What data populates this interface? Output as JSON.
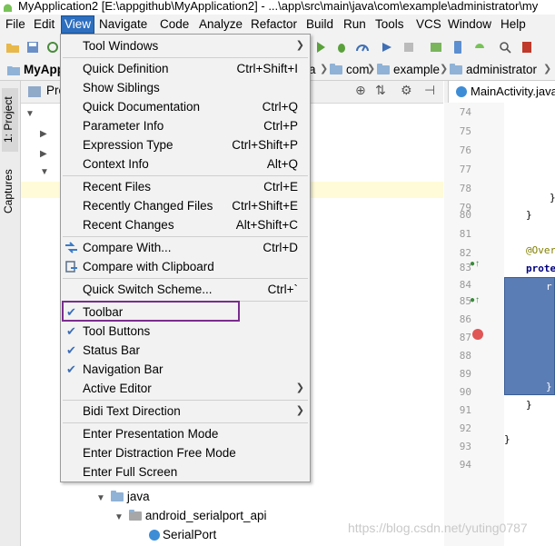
{
  "window": {
    "title": "MyApplication2 [E:\\appgithub\\MyApplication2] - ...\\app\\src\\main\\java\\com\\example\\administrator\\my"
  },
  "menubar": {
    "items": [
      "File",
      "Edit",
      "View",
      "Navigate",
      "Code",
      "Analyze",
      "Refactor",
      "Build",
      "Run",
      "Tools",
      "VCS",
      "Window",
      "Help"
    ],
    "active": "View"
  },
  "navbar": {
    "project": "MyAppl",
    "crumbs": [
      "a",
      "com",
      "example",
      "administrator"
    ]
  },
  "left_strip": {
    "tabs": [
      "1: Project",
      "Captures"
    ]
  },
  "project_panel": {
    "header": "Pro",
    "tree": [
      {
        "label": "java"
      },
      {
        "label": "android_serialport_api"
      },
      {
        "label": "SerialPort"
      }
    ]
  },
  "editor": {
    "tab": "MainActivity.java",
    "line_numbers": [
      "74",
      "75",
      "76",
      "77",
      "78",
      "79",
      "80",
      "81",
      "82",
      "83",
      "84",
      "85",
      "86",
      "87",
      "88",
      "89",
      "90",
      "91",
      "92",
      "93",
      "94"
    ],
    "code": {
      "l79": "}",
      "l80": "}",
      "l82": "@Overr",
      "l83": "prote",
      "l84": "r",
      "l90": "}",
      "l91": "}",
      "l93": "}"
    }
  },
  "view_menu": {
    "items": [
      {
        "label": "Tool Windows",
        "shortcut": "",
        "submenu": true
      },
      {
        "label": "Quick Definition",
        "shortcut": "Ctrl+Shift+I"
      },
      {
        "label": "Show Siblings",
        "shortcut": ""
      },
      {
        "label": "Quick Documentation",
        "shortcut": "Ctrl+Q"
      },
      {
        "label": "Parameter Info",
        "shortcut": "Ctrl+P"
      },
      {
        "label": "Expression Type",
        "shortcut": "Ctrl+Shift+P"
      },
      {
        "label": "Context Info",
        "shortcut": "Alt+Q"
      },
      {
        "label": "Recent Files",
        "shortcut": "Ctrl+E"
      },
      {
        "label": "Recently Changed Files",
        "shortcut": "Ctrl+Shift+E"
      },
      {
        "label": "Recent Changes",
        "shortcut": "Alt+Shift+C"
      },
      {
        "label": "Compare With...",
        "shortcut": "Ctrl+D",
        "icon": "compare-icon"
      },
      {
        "label": "Compare with Clipboard",
        "shortcut": "",
        "icon": "clipboard-compare-icon"
      },
      {
        "label": "Quick Switch Scheme...",
        "shortcut": "Ctrl+`"
      },
      {
        "label": "Toolbar",
        "shortcut": "",
        "checked": true
      },
      {
        "label": "Tool Buttons",
        "shortcut": "",
        "checked": true
      },
      {
        "label": "Status Bar",
        "shortcut": "",
        "checked": true
      },
      {
        "label": "Navigation Bar",
        "shortcut": "",
        "checked": true
      },
      {
        "label": "Active Editor",
        "shortcut": "",
        "submenu": true
      },
      {
        "label": "Bidi Text Direction",
        "shortcut": "",
        "submenu": true
      },
      {
        "label": "Enter Presentation Mode",
        "shortcut": ""
      },
      {
        "label": "Enter Distraction Free Mode",
        "shortcut": ""
      },
      {
        "label": "Enter Full Screen",
        "shortcut": ""
      }
    ]
  },
  "watermark": "https://blog.csdn.net/yuting0787",
  "colors": {
    "menu_active": "#2e6fbf",
    "highlight_box": "#7a2d8e",
    "selection_block": "#5b7db5",
    "breakpoint": "#e05555"
  }
}
